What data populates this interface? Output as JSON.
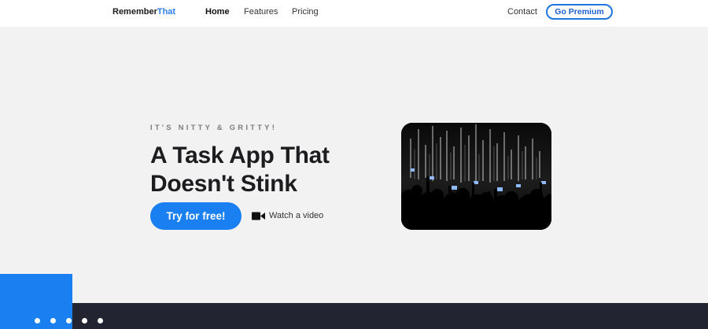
{
  "brand": {
    "name_part1": "Remember",
    "name_part2": "That"
  },
  "nav": {
    "links": [
      "Home",
      "Features",
      "Pricing"
    ],
    "contact": "Contact",
    "premium": "Go Premium"
  },
  "hero": {
    "eyebrow": "IT'S NITTY & GRITTY!",
    "headline_line1": "A Task App That",
    "headline_line2": "Doesn't Stink",
    "cta": "Try for free!",
    "video_link": "Watch a video",
    "image_description_icon": "concert-crowd-photo"
  },
  "colors": {
    "accent": "#1a7ff0",
    "dark_band": "#222531",
    "background": "#f2f2f3"
  },
  "slider": {
    "dot_count": 5
  }
}
